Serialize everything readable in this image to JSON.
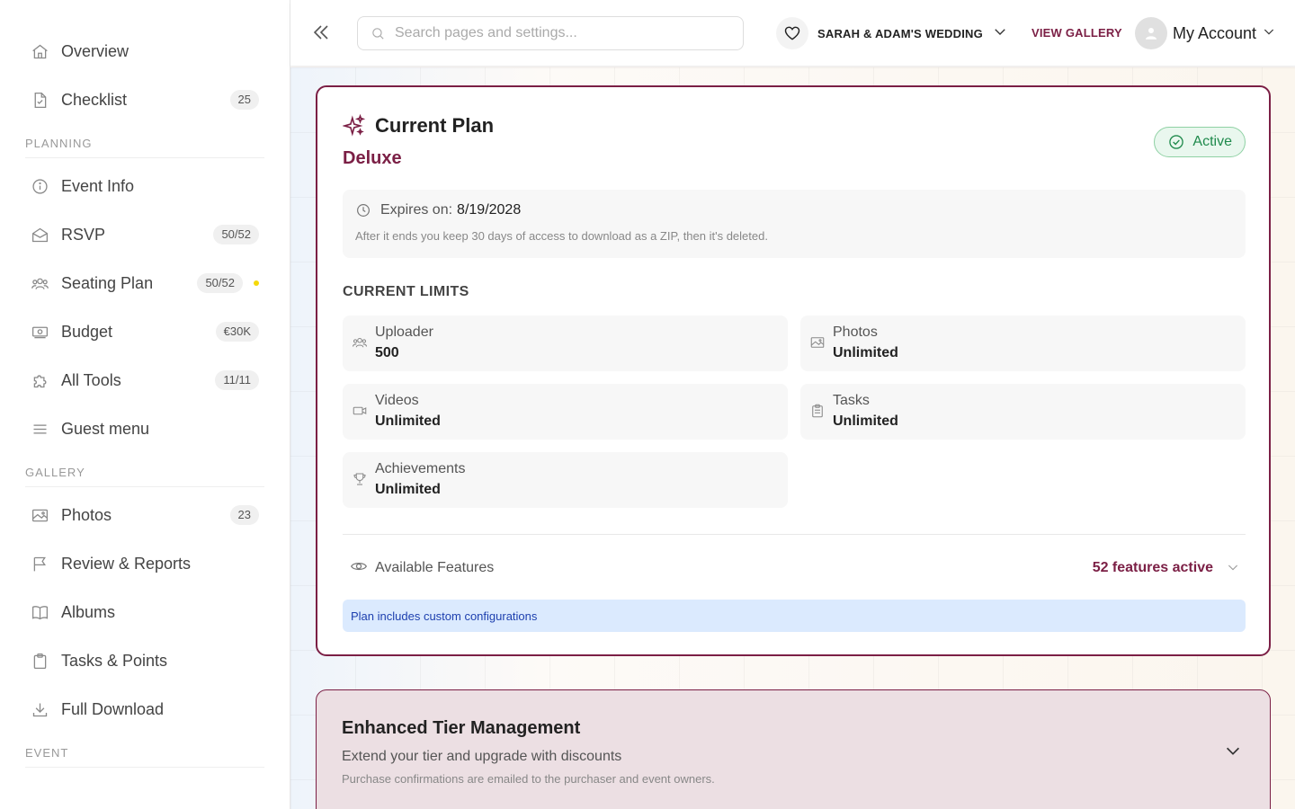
{
  "sidebar": {
    "items_top": [
      {
        "label": "Overview",
        "icon": "home-icon"
      },
      {
        "label": "Checklist",
        "icon": "checklist-icon",
        "badge": "25"
      }
    ],
    "planning_head": "PLANNING",
    "planning": [
      {
        "label": "Event Info",
        "icon": "info-icon"
      },
      {
        "label": "RSVP",
        "icon": "envelope-icon",
        "badge": "50/52"
      },
      {
        "label": "Seating Plan",
        "icon": "people-icon",
        "badge": "50/52"
      },
      {
        "label": "Budget",
        "icon": "money-icon",
        "badge": "€30K"
      },
      {
        "label": "All Tools",
        "icon": "puzzle-icon",
        "badge": "11/11"
      },
      {
        "label": "Guest menu",
        "icon": "menu-icon"
      }
    ],
    "gallery_head": "GALLERY",
    "gallery": [
      {
        "label": "Photos",
        "icon": "image-icon",
        "badge": "23"
      },
      {
        "label": "Review & Reports",
        "icon": "flag-icon"
      },
      {
        "label": "Albums",
        "icon": "book-icon"
      },
      {
        "label": "Tasks & Points",
        "icon": "clipboard-icon"
      },
      {
        "label": "Full Download",
        "icon": "download-icon"
      }
    ],
    "event_head": "EVENT"
  },
  "topbar": {
    "search_placeholder": "Search pages and settings...",
    "event_name": "SARAH & ADAM'S WEDDING",
    "view_gallery": "VIEW GALLERY",
    "account": "My Account"
  },
  "plan": {
    "title": "Current Plan",
    "name": "Deluxe",
    "status": "Active",
    "expires_label": "Expires on:",
    "expires_date": "8/19/2028",
    "expires_note": "After it ends you keep 30 days of access to download as a ZIP, then it's deleted.",
    "limits_head": "CURRENT LIMITS",
    "limits": [
      {
        "name": "Uploader",
        "value": "500",
        "icon": "people-icon"
      },
      {
        "name": "Photos",
        "value": "Unlimited",
        "icon": "image-icon"
      },
      {
        "name": "Videos",
        "value": "Unlimited",
        "icon": "video-icon"
      },
      {
        "name": "Tasks",
        "value": "Unlimited",
        "icon": "clipboard-icon"
      },
      {
        "name": "Achievements",
        "value": "Unlimited",
        "icon": "trophy-icon"
      }
    ],
    "features_label": "Available Features",
    "features_count": "52 features active",
    "config_note": "Plan includes custom configurations"
  },
  "tier": {
    "title": "Enhanced Tier Management",
    "subtitle": "Extend your tier and upgrade with discounts",
    "note": "Purchase confirmations are emailed to the purchaser and event owners."
  },
  "colors": {
    "brand": "#7b1f45",
    "active_green": "#1f8a4c",
    "info_blue": "#1e40af",
    "seating_dot": "#f5d90a"
  }
}
